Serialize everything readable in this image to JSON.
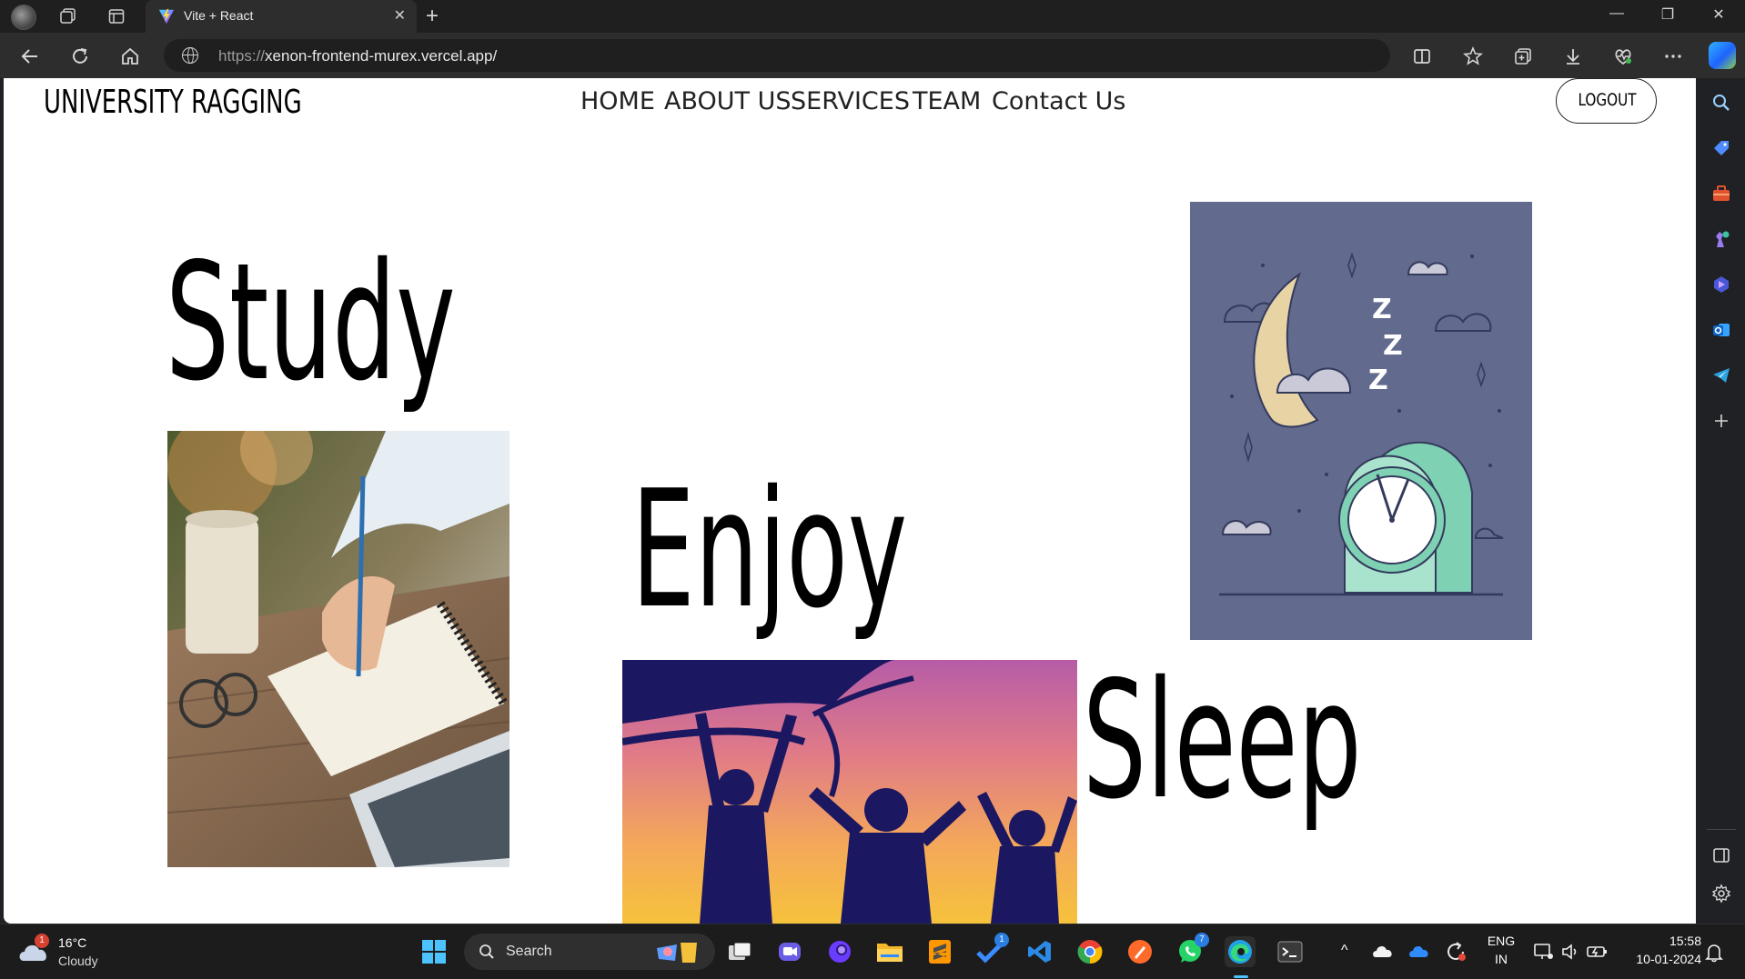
{
  "browser": {
    "tab_title": "Vite + React",
    "url_scheme": "https://",
    "url_rest": "xenon-frontend-murex.vercel.app/",
    "new_tab_symbol": "+",
    "close_tab_symbol": "✕",
    "window_controls": {
      "minimize": "—",
      "maximize": "❐",
      "close": "✕"
    },
    "toolbar_icons": [
      "back-icon",
      "refresh-icon",
      "home-icon",
      "globe-icon",
      "split-screen-icon",
      "favorites-icon",
      "collections-icon",
      "downloads-icon",
      "browser-essentials-icon",
      "more-icon",
      "copilot-icon"
    ],
    "sidebar_icons": [
      "search-icon",
      "shopping-icon",
      "tools-icon",
      "games-icon",
      "copilot-app-icon",
      "outlook-icon",
      "telegram-icon",
      "add-icon",
      "sidebar-toggle-icon",
      "settings-icon"
    ]
  },
  "page": {
    "brand": "UNIVERSITY RAGGING",
    "nav": [
      {
        "label": "HOME"
      },
      {
        "label": "ABOUT US"
      },
      {
        "label": "SERVICES"
      },
      {
        "label": "TEAM"
      },
      {
        "label": "Contact Us"
      }
    ],
    "logout_label": "LOGOUT",
    "words": {
      "study": "Study",
      "enjoy": "Enjoy",
      "sleep": "Sleep"
    },
    "images": {
      "study": "writing-in-notebook-photo",
      "enjoy": "friends-jumping-at-sunset-photo",
      "sleep": "moon-and-alarm-clock-illustration"
    },
    "sleep_illustration_letters": [
      "Z",
      "Z",
      "Z"
    ]
  },
  "taskbar": {
    "weather_badge": "1",
    "weather_temp": "16°C",
    "weather_desc": "Cloudy",
    "search_label": "Search",
    "apps": [
      "windows-start-icon",
      "search-icon",
      "task-view-icon",
      "teams-icon",
      "copilot-icon",
      "file-explorer-icon",
      "sublime-icon",
      "todo-icon",
      "vscode-icon",
      "chrome-icon",
      "brave-icon",
      "whatsapp-icon",
      "edge-icon",
      "terminal-icon"
    ],
    "todo_badge": "1",
    "whatsapp_badge": "7",
    "tray_caret": "^",
    "language_line1": "ENG",
    "language_line2": "IN",
    "time": "15:58",
    "date": "10-01-2024"
  },
  "colors": {
    "page_bg": "#ffffff",
    "chrome_bg": "#2d2d2d",
    "titlebar_bg": "#1f1f1f",
    "sleep_illustration_bg": "#626a8e",
    "clock_green": "#7fd1b4",
    "moon": "#e8d3a5",
    "sunset_top": "#b65ca7",
    "sunset_bottom": "#f6c23c"
  }
}
